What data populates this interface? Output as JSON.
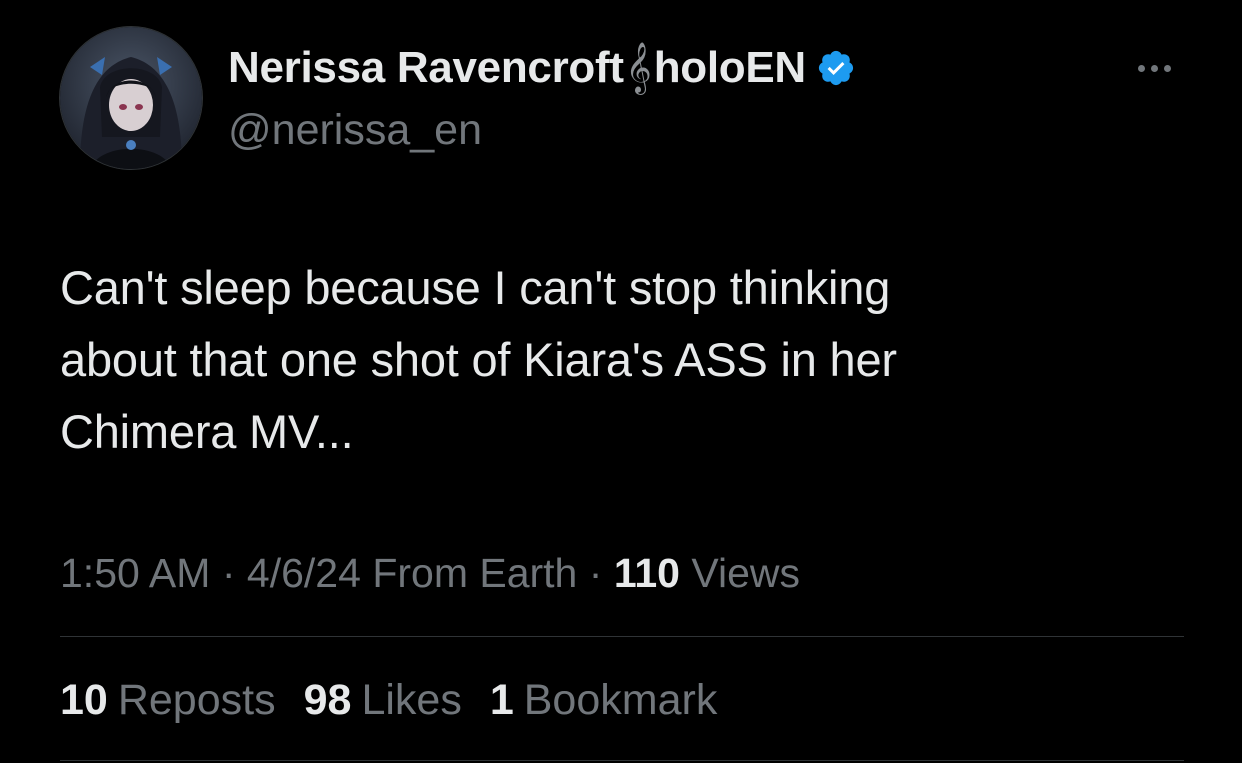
{
  "user": {
    "display_name": "Nerissa Ravencroft",
    "name_glyph": "𝄞",
    "name_suffix": "holoEN",
    "handle": "@nerissa_en",
    "verified": true,
    "verified_color": "#1d9bf0"
  },
  "tweet": {
    "text": "Can't sleep because I can't stop thinking\nabout that one shot of Kiara's ASS in her\nChimera MV..."
  },
  "meta": {
    "time": "1:50 AM",
    "separator": "·",
    "date": "4/6/24",
    "location": "From Earth",
    "views_count": "110",
    "views_label": "Views"
  },
  "stats": {
    "reposts_count": "10",
    "reposts_label": "Reposts",
    "likes_count": "98",
    "likes_label": "Likes",
    "bookmarks_count": "1",
    "bookmarks_label": "Bookmark"
  },
  "icons": {
    "more": "more-icon",
    "verified": "verified-badge-icon",
    "avatar": "avatar"
  },
  "colors": {
    "background": "#000000",
    "primary_text": "#e7e9ea",
    "secondary_text": "#71767b",
    "divider": "#2f3336"
  }
}
